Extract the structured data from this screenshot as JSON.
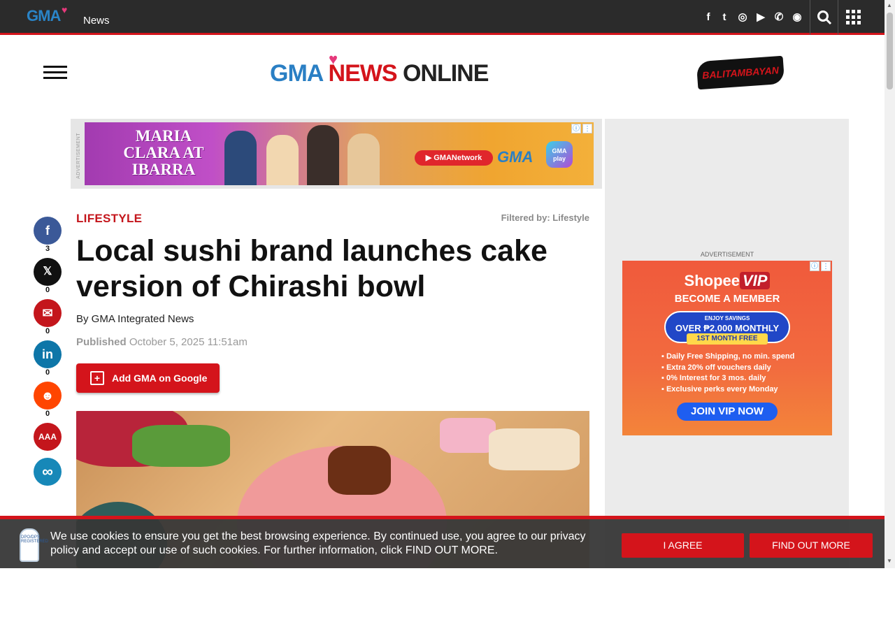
{
  "topbar": {
    "logo": "GMA",
    "section_label": "News",
    "social_icons": [
      "facebook-icon",
      "twitter-icon",
      "instagram-icon",
      "youtube-icon",
      "viber-icon",
      "rss-icon"
    ],
    "social_glyphs": [
      "f",
      "t",
      "◎",
      "▶",
      "✆",
      "◉"
    ],
    "search_glyph": "⌕",
    "apps_glyph": "⋮⋮⋮"
  },
  "header": {
    "logo_gma": "GMA",
    "logo_news": "NEWS",
    "logo_online": "ONLINE",
    "partner_logo": "BALITAMBAYAN"
  },
  "ad_banner": {
    "label": "ADVERTISEMENT",
    "title": "MARIA CLARA AT IBARRA",
    "youtube_label": "GMANetwork",
    "gma_logo": "GMA",
    "gma_play": "GMA play"
  },
  "sidebar_ad": {
    "label": "ADVERTISEMENT",
    "brand": "Shopee",
    "brand_vip": "VIP",
    "become": "BECOME A MEMBER",
    "enjoy": "ENJOY SAVINGS",
    "over": "OVER ₱2,000 MONTHLY",
    "first_month": "1ST MONTH FREE",
    "perks": [
      "Daily Free Shipping, no min. spend",
      "Extra 20% off vouchers daily",
      "0% Interest for 3 mos. daily",
      "Exclusive perks every Monday"
    ],
    "cta": "JOIN VIP NOW"
  },
  "share_rail": [
    {
      "name": "facebook",
      "glyph": "f",
      "count": "3",
      "color": "#3b5998"
    },
    {
      "name": "x",
      "glyph": "𝕏",
      "count": "0",
      "color": "#111111"
    },
    {
      "name": "email",
      "glyph": "✉",
      "count": "0",
      "color": "#c4161c"
    },
    {
      "name": "linkedin",
      "glyph": "in",
      "count": "0",
      "color": "#0e76a8"
    },
    {
      "name": "reddit",
      "glyph": "☻",
      "count": "0",
      "color": "#ff4500"
    },
    {
      "name": "font-size",
      "glyph": "AAA",
      "count": "",
      "color": "#c4161c"
    },
    {
      "name": "copy-link",
      "glyph": "∞",
      "count": "",
      "color": "#1788b8"
    }
  ],
  "article": {
    "section": "LIFESTYLE",
    "filtered_by": "Filtered by: Lifestyle",
    "headline": "Local sushi brand launches cake version of Chirashi bowl",
    "byline": "By GMA Integrated News",
    "published_label": "Published",
    "published_date": "October 5, 2025 11:51am",
    "add_google_label": "Add GMA on Google"
  },
  "cookie_banner": {
    "text": "We use cookies to ensure you get the best browsing experience. By continued use, you agree to our privacy policy and accept our use of such cookies. For further information, click FIND OUT MORE.",
    "agree_label": "I AGREE",
    "more_label": "FIND OUT MORE",
    "badge": "DPO/DPS REGISTERED"
  },
  "colors": {
    "brand_red": "#d4141b",
    "brand_blue": "#2a7fc4",
    "topbar_bg": "#2b2b2b"
  }
}
